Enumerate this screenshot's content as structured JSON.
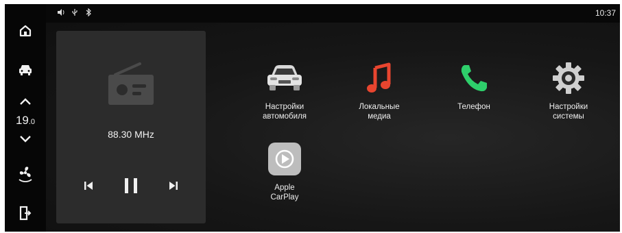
{
  "status_bar": {
    "time": "10:37",
    "icons": [
      "volume-icon",
      "usb-icon",
      "bluetooth-icon"
    ]
  },
  "sidebar": {
    "temperature": "19",
    "temperature_decimal": ".0",
    "buttons": [
      "home-icon",
      "car-icon",
      "chevron-up-icon",
      "chevron-down-icon",
      "fan-icon",
      "seat-exit-icon"
    ]
  },
  "radio": {
    "frequency": "88.30 MHz",
    "controls": [
      "previous-icon",
      "pause-icon",
      "next-icon"
    ]
  },
  "apps": [
    {
      "label": "Настройки\nавтомобиля",
      "icon": "car-front-icon"
    },
    {
      "label": "Локальные\nмедиа",
      "icon": "music-note-icon",
      "color": "#e8452f"
    },
    {
      "label": "Телефон",
      "icon": "phone-icon",
      "color": "#2ecf6b"
    },
    {
      "label": "Настройки\nсистемы",
      "icon": "gear-icon"
    },
    {
      "label": "Apple\nCarPlay",
      "icon": "carplay-icon"
    }
  ]
}
